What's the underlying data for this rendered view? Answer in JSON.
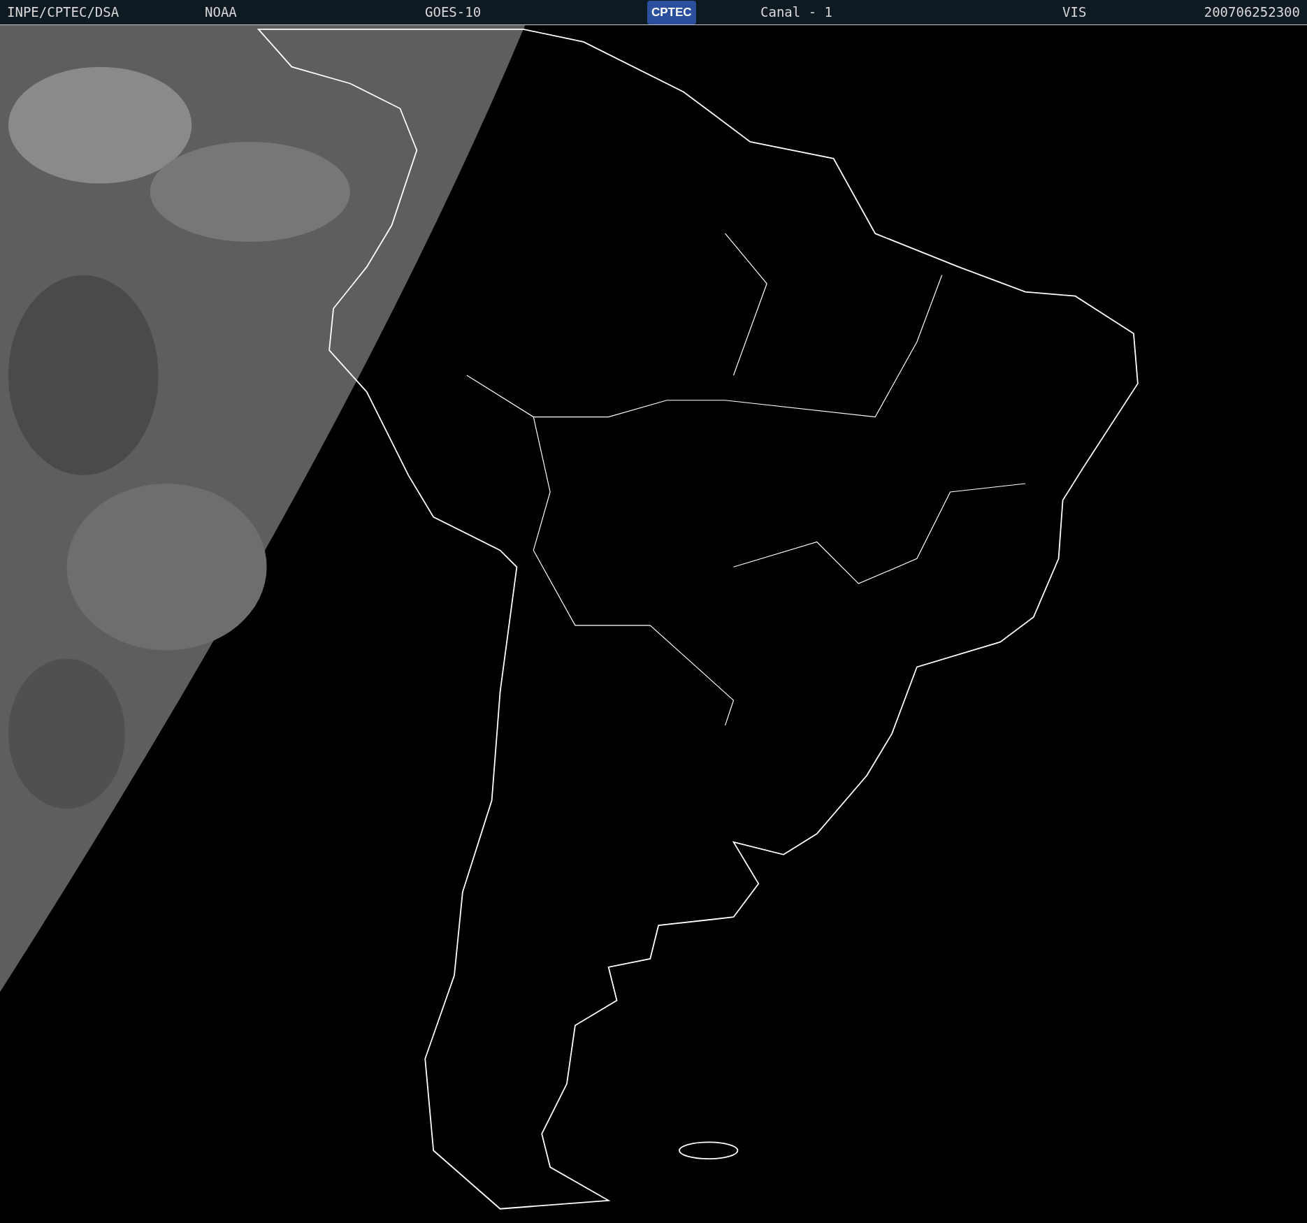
{
  "header": {
    "fields": [
      {
        "kind": "text",
        "text": "INPE/CPTEC/DSA"
      },
      {
        "kind": "text",
        "text": "NOAA"
      },
      {
        "kind": "text",
        "text": "GOES-10"
      },
      {
        "kind": "logo",
        "text": "CPTEC"
      },
      {
        "kind": "text",
        "text": "Canal - 1"
      },
      {
        "kind": "text",
        "text": "VIS"
      },
      {
        "kind": "text",
        "text": "200706252300"
      }
    ]
  }
}
